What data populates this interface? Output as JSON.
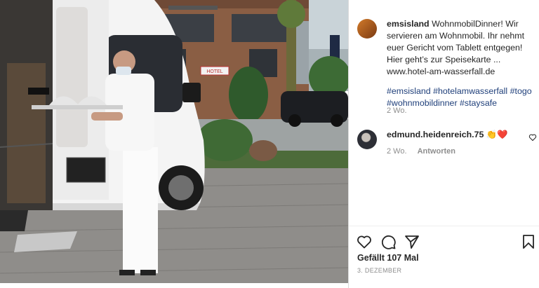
{
  "post": {
    "username": "emsisland",
    "caption_line1": "WohnmobilDinner! Wir servieren am Wohnmobil. Ihr nehmt euer Gericht vom Tablett entgegen! Hier geht’s zur Speisekarte ...",
    "caption_url": "www.hotel-am-wasserfall.de",
    "hashtags": "#emsisland #hotelamwasserfall #togo #wohnmobildinner #staysafe",
    "time_ago": "2 Wo."
  },
  "comment": {
    "username": "edmund.heidenreich.75",
    "text": "👏❤️",
    "time_ago": "2 Wo.",
    "reply_label": "Antworten"
  },
  "actions": {
    "likes": "Gefällt 107 Mal",
    "date": "3. DEZEMBER"
  },
  "photo": {
    "sign_text": "HOTEL"
  },
  "colors": {
    "hashtag": "#1f3f7a",
    "muted": "#8e8e8e",
    "heart": "#ed4956"
  }
}
